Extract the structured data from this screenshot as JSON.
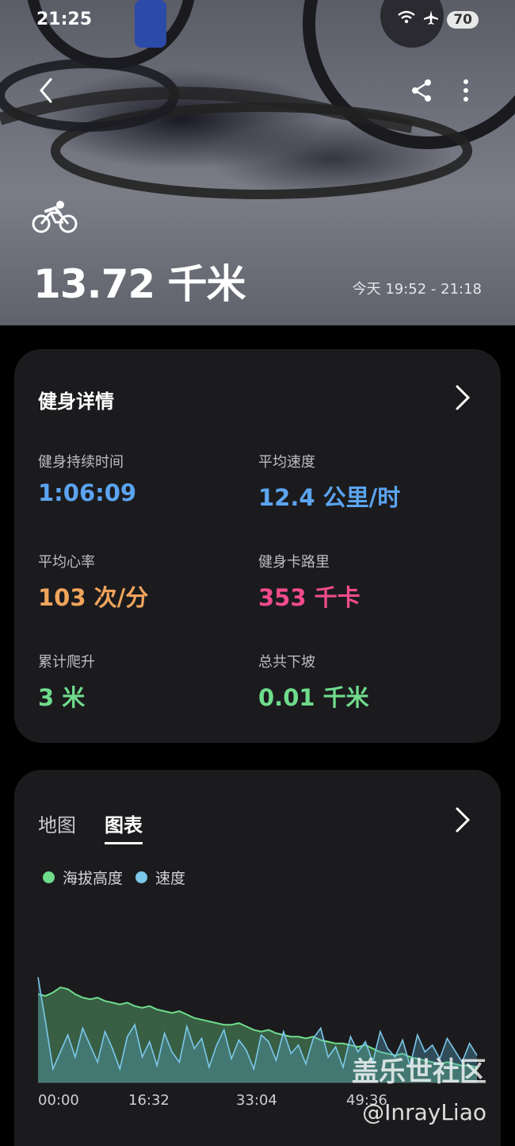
{
  "status_bar": {
    "time": "21:25",
    "battery": "70"
  },
  "hero": {
    "distance": "13.72 千米",
    "date_range": "今天 19:52 - 21:18"
  },
  "details": {
    "title": "健身详情",
    "metrics": [
      {
        "label": "健身持续时间",
        "value": "1:06:09",
        "color": "#5ba4f0"
      },
      {
        "label": "平均速度",
        "value": "12.4 公里/时",
        "color": "#5ba4f0"
      },
      {
        "label": "平均心率",
        "value": "103 次/分",
        "color": "#f0a45c"
      },
      {
        "label": "健身卡路里",
        "value": "353 千卡",
        "color": "#f04c8c"
      },
      {
        "label": "累计爬升",
        "value": "3 米",
        "color": "#6fdc8c"
      },
      {
        "label": "总共下坡",
        "value": "0.01 千米",
        "color": "#6fdc8c"
      }
    ]
  },
  "chart_card": {
    "tabs": [
      "地图",
      "图表"
    ],
    "active_tab": "图表",
    "watermark": "盖乐世社区",
    "watermark_user": "@InrayLiao"
  },
  "chart_data": {
    "type": "area",
    "series": [
      {
        "name": "海拔高度",
        "color": "#6fdc8c",
        "values": [
          0.52,
          0.51,
          0.53,
          0.56,
          0.55,
          0.52,
          0.5,
          0.49,
          0.5,
          0.48,
          0.47,
          0.46,
          0.47,
          0.45,
          0.44,
          0.45,
          0.43,
          0.42,
          0.41,
          0.42,
          0.4,
          0.38,
          0.37,
          0.36,
          0.35,
          0.34,
          0.34,
          0.35,
          0.33,
          0.31,
          0.3,
          0.31,
          0.29,
          0.28,
          0.27,
          0.27,
          0.26,
          0.27,
          0.25,
          0.24,
          0.23,
          0.23,
          0.22,
          0.21,
          0.22,
          0.2,
          0.18,
          0.17,
          0.16,
          0.17,
          0.15,
          0.14,
          0.13,
          0.12,
          0.11,
          0.12,
          0.11,
          0.1,
          0.1,
          0.09
        ]
      },
      {
        "name": "速度",
        "color": "#7cc8ea",
        "values": [
          0.62,
          0.36,
          0.08,
          0.18,
          0.28,
          0.15,
          0.32,
          0.22,
          0.12,
          0.3,
          0.2,
          0.08,
          0.27,
          0.34,
          0.15,
          0.24,
          0.1,
          0.29,
          0.18,
          0.12,
          0.33,
          0.2,
          0.26,
          0.09,
          0.22,
          0.31,
          0.14,
          0.25,
          0.19,
          0.08,
          0.28,
          0.24,
          0.13,
          0.3,
          0.17,
          0.22,
          0.11,
          0.26,
          0.32,
          0.15,
          0.21,
          0.09,
          0.27,
          0.18,
          0.24,
          0.12,
          0.3,
          0.2,
          0.15,
          0.25,
          0.1,
          0.28,
          0.18,
          0.22,
          0.14,
          0.26,
          0.19,
          0.12,
          0.23,
          0.16
        ]
      }
    ],
    "x_ticks": [
      "00:00",
      "16:32",
      "33:04",
      "49:36"
    ]
  }
}
